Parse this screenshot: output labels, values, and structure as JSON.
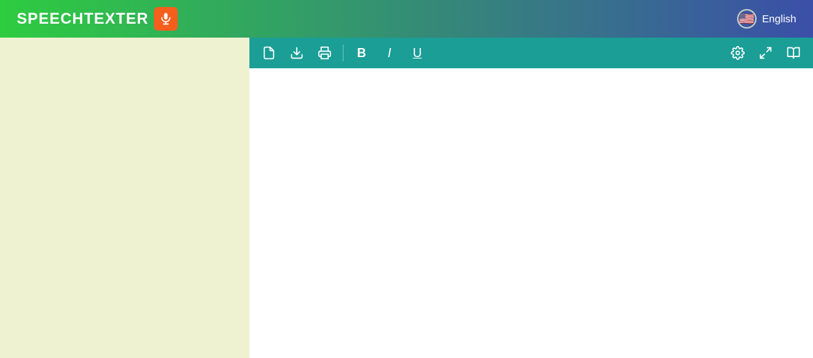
{
  "header": {
    "logo_text": "SPEECHTEXTER",
    "language_label": "English",
    "flag_emoji": "🇺🇸"
  },
  "toolbar": {
    "new_doc_tooltip": "New Document",
    "download_tooltip": "Download",
    "print_tooltip": "Print",
    "bold_label": "B",
    "italic_label": "I",
    "underline_label": "U",
    "settings_tooltip": "Settings",
    "fullscreen_tooltip": "Fullscreen",
    "help_tooltip": "Help"
  },
  "editor": {
    "placeholder": ""
  },
  "sidebar": {
    "background_color": "#eef2d0"
  }
}
